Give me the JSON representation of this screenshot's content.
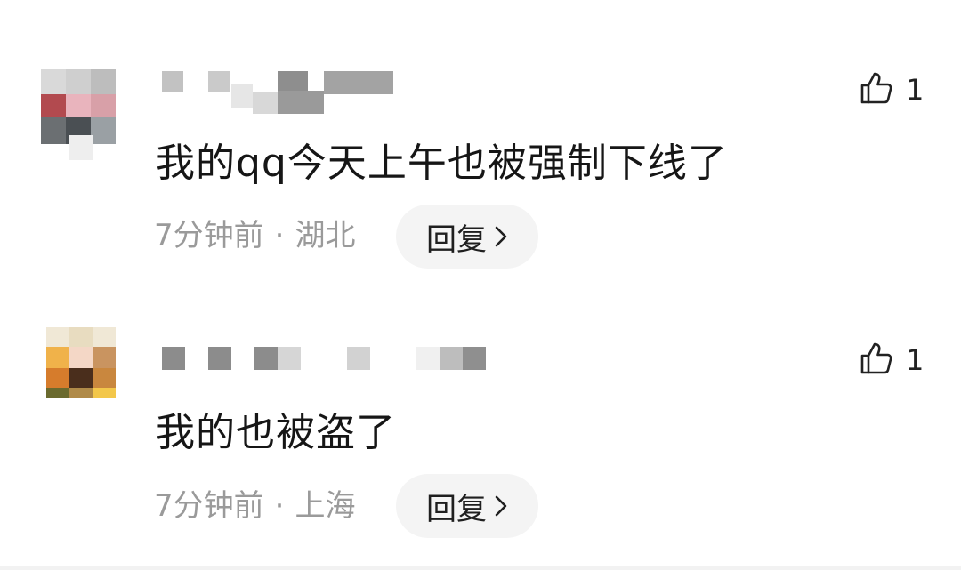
{
  "comments": [
    {
      "text": "我的qq今天上午也被强制下线了",
      "time": "7分钟前",
      "separator": "·",
      "location": "湖北",
      "reply_label": "回复",
      "like_count": "1",
      "like_icon": "thumbs-up-icon",
      "reply_icon": "chevron-right-icon"
    },
    {
      "text": "我的也被盗了",
      "time": "7分钟前",
      "separator": "·",
      "location": "上海",
      "reply_label": "回复",
      "like_count": "1",
      "like_icon": "thumbs-up-icon",
      "reply_icon": "chevron-right-icon"
    }
  ]
}
